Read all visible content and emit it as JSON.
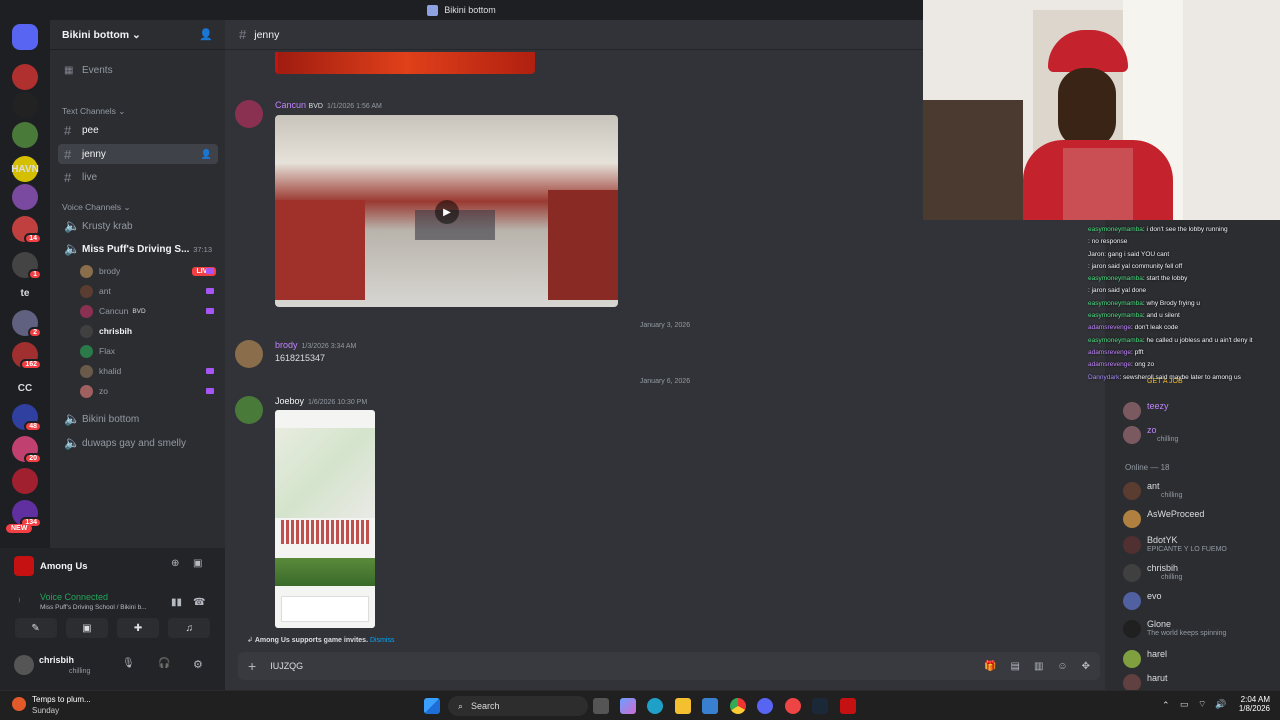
{
  "window": {
    "title": "Bikini bottom"
  },
  "servers": [
    {
      "label": "",
      "color": "#5865f2",
      "badge": ""
    },
    {
      "label": "",
      "color": "#b03030",
      "badge": ""
    },
    {
      "label": "",
      "color": "#222222",
      "badge": ""
    },
    {
      "label": "",
      "color": "#4a7a3a",
      "badge": ""
    },
    {
      "label": "HAVN",
      "color": "#d4c000",
      "badge": ""
    },
    {
      "label": "",
      "color": "#7a4aa0",
      "badge": ""
    },
    {
      "label": "",
      "color": "#c04040",
      "badge": "14"
    },
    {
      "label": "",
      "color": "#444444",
      "badge": "1"
    },
    {
      "label": "te",
      "color": "#1e1f22",
      "badge": ""
    },
    {
      "label": "",
      "color": "#606080",
      "badge": "2"
    },
    {
      "label": "",
      "color": "#a03030",
      "badge": "162"
    },
    {
      "label": "CC",
      "color": "#1e1f22",
      "badge": ""
    },
    {
      "label": "",
      "color": "#3040a0",
      "badge": "48"
    },
    {
      "label": "",
      "color": "#c04070",
      "badge": "20"
    },
    {
      "label": "",
      "color": "#a02030",
      "badge": ""
    },
    {
      "label": "",
      "color": "#6030a0",
      "badge": "134"
    }
  ],
  "new_badge": "NEW",
  "guild": {
    "name": "Bikini bottom",
    "events": "Events",
    "text_category": "Text Channels",
    "text_channels": [
      "pee",
      "jenny",
      "live"
    ],
    "active_channel": "jenny",
    "voice_category": "Voice Channels",
    "voice_channels": [
      "Krusty krab",
      "Miss Puff's Driving S...",
      "Bikini bottom",
      "duwaps gay and smelly"
    ],
    "voice_timer": "37:13",
    "voice_users": [
      {
        "name": "brody",
        "live": "LIVE",
        "color": "#8a6d4a"
      },
      {
        "name": "ant",
        "live": "",
        "color": "#5a3d30"
      },
      {
        "name": "Cancun",
        "tag": "BVD",
        "live": "",
        "color": "#8a3050"
      },
      {
        "name": "chrisbih",
        "live": "",
        "color": "#404040"
      },
      {
        "name": "Flax",
        "live": "",
        "color": "#2a7a4a"
      },
      {
        "name": "khalid",
        "live": "",
        "color": "#6a5a4a"
      },
      {
        "name": "zo",
        "live": "",
        "color": "#a06060"
      }
    ]
  },
  "activity": {
    "name": "Among Us"
  },
  "voice": {
    "status": "Voice Connected",
    "location": "Miss Puff's Driving School / Bikini b..."
  },
  "user": {
    "name": "chrisbih",
    "status": "chilling"
  },
  "chat": {
    "channel": "jenny",
    "messages": [
      {
        "author": "Cancun",
        "tag": "BVD",
        "time": "1/1/2026 1:56 AM",
        "color": "#c084fc"
      },
      {
        "author": "brody",
        "time": "1/3/2026 3:34 AM",
        "text": "1618215347",
        "color": "#c084fc"
      },
      {
        "author": "Joeboy",
        "time": "1/6/2026 10:30 PM",
        "color": "#f2f3f5"
      }
    ],
    "dividers": [
      "January 3, 2026",
      "January 6, 2026"
    ],
    "invite_notice": "Among Us supports game invites.",
    "dismiss": "Dismiss",
    "input_value": "IUJZQG"
  },
  "overlay_chat": [
    {
      "user": "easymoneymamba",
      "text": ": i don't see the lobby running",
      "color": "#4ade80"
    },
    {
      "user": "",
      "text": ": no response",
      "color": "#f87171"
    },
    {
      "user": "Jaron",
      "text": ": gang i said YOU cant",
      "color": "#f2f3f5"
    },
    {
      "user": "",
      "text": ": jaron said yal community fell off",
      "color": "#60a5fa"
    },
    {
      "user": "easymoneymamba",
      "text": ": start the lobby",
      "color": "#4ade80"
    },
    {
      "user": "",
      "text": ": jaron said yal done",
      "color": "#60a5fa"
    },
    {
      "user": "easymoneymamba",
      "text": ": why Brody frying u",
      "color": "#4ade80"
    },
    {
      "user": "easymoneymamba",
      "text": ": and u silent",
      "color": "#4ade80"
    },
    {
      "user": "adamsrevenge",
      "text": ": don't leak code",
      "color": "#c084fc"
    },
    {
      "user": "easymoneymamba",
      "text": ": he called u jobless and u ain't deny it",
      "color": "#4ade80"
    },
    {
      "user": "adamsrevenge",
      "text": ": pfft",
      "color": "#c084fc"
    },
    {
      "user": "adamsrevenge",
      "text": ": ong zo",
      "color": "#c084fc"
    },
    {
      "user": "Dannydark",
      "text": ": sewsheroll said maybe later to among us",
      "color": "#a78bfa"
    }
  ],
  "members": {
    "top": [
      {
        "name": "GET A JOB",
        "status": "",
        "color": "#fbbf24"
      },
      {
        "name": "teezy",
        "status": "",
        "color": "#c084fc"
      },
      {
        "name": "zo",
        "status": "chilling",
        "color": "#c084fc"
      }
    ],
    "online_header": "Online — 18",
    "online": [
      {
        "name": "ant",
        "status": "chilling",
        "color": "#5a3d30"
      },
      {
        "name": "AsWeProceed",
        "status": "",
        "color": "#b08040"
      },
      {
        "name": "BdotYK",
        "status": "EPICANTE Y LO FUEMO",
        "color": "#503030"
      },
      {
        "name": "chrisbih",
        "status": "chilling",
        "color": "#404040"
      },
      {
        "name": "evo",
        "status": "",
        "color": "#5060a0"
      },
      {
        "name": "Glone",
        "status": "The world keeps spinning",
        "color": "#202020"
      },
      {
        "name": "harel",
        "status": "",
        "color": "#80a040"
      },
      {
        "name": "harut",
        "status": "",
        "color": "#604040"
      }
    ]
  },
  "taskbar": {
    "weather": "Temps to plum...",
    "weather_sub": "Sunday",
    "search": "Search",
    "time": "2:04 AM",
    "date": "1/8/2026"
  }
}
